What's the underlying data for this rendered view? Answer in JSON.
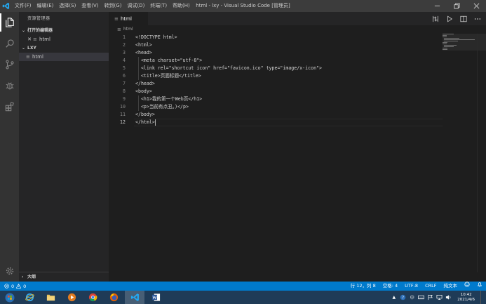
{
  "app": {
    "window_title": "html - lxy - Visual Studio Code [管理员]",
    "menus": [
      "文件(F)",
      "编辑(E)",
      "选择(S)",
      "查看(V)",
      "转到(G)",
      "调试(D)",
      "终端(T)",
      "帮助(H)"
    ]
  },
  "sidebar": {
    "title": "资源管理器",
    "open_editors_label": "打开的编辑器",
    "open_editors": [
      {
        "name": "html"
      }
    ],
    "workspace_label": "LXY",
    "files": [
      {
        "name": "html"
      }
    ],
    "outline_label": "大纲"
  },
  "editor": {
    "tab_label": "html",
    "breadcrumb": "html",
    "lines": [
      {
        "n": "1",
        "text": "<!DOCTYPE html>"
      },
      {
        "n": "2",
        "text": "<html>"
      },
      {
        "n": "3",
        "text": "<head>"
      },
      {
        "n": "4",
        "text": "  <meta charset=\"utf-8\">"
      },
      {
        "n": "5",
        "text": "  <link rel=\"shortcut icon\" href=\"favicon.ico\" type=\"image/x-icon\">"
      },
      {
        "n": "6",
        "text": "  <title>页面标题</title>"
      },
      {
        "n": "7",
        "text": "</head>"
      },
      {
        "n": "8",
        "text": "<body>"
      },
      {
        "n": "9",
        "text": "  <h1>我的第一个Web页</h1>"
      },
      {
        "n": "10",
        "text": "  <p>当前有点丑。)</p>"
      },
      {
        "n": "11",
        "text": "</body>"
      },
      {
        "n": "12",
        "text": "</html>"
      }
    ]
  },
  "statusbar": {
    "errors": "0",
    "warnings": "0",
    "position": "行 12，列 8",
    "indent": "空格: 4",
    "encoding": "UTF-8",
    "eol": "CRLF",
    "language": "纯文本"
  },
  "taskbar": {
    "ime": "中",
    "time": "10:42",
    "date": "2021/4/6"
  },
  "colors": {
    "accent": "#007acc",
    "titlebar": "#3c3c3c",
    "activitybar": "#333333",
    "sidebar": "#252526",
    "editor_bg": "#1e1e1e",
    "taskbar": "#1f3b57"
  }
}
